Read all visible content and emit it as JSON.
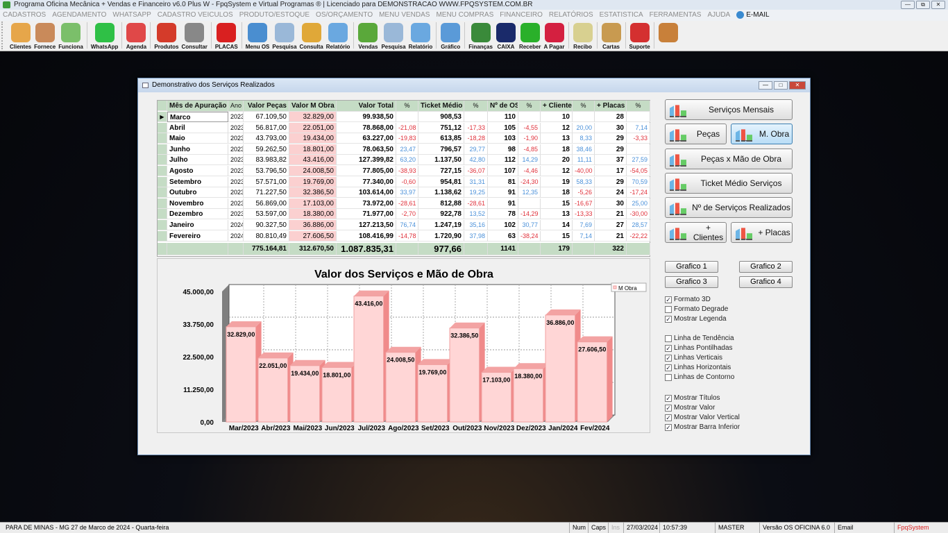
{
  "app": {
    "title": "Programa Oficina Mecânica + Vendas e Financeiro v6.0 Plus W - FpqSystem e Virtual Programas ® | Licenciado para  DEMONSTRACAO WWW.FPQSYSTEM.COM.BR"
  },
  "menu": [
    "CADASTROS",
    "AGENDAMENTO",
    "WHATSAPP",
    "CADASTRO VEICULOS",
    "PRODUTO/ESTOQUE",
    "OS/ORÇAMENTO",
    "MENU VENDAS",
    "MENU COMPRAS",
    "FINANCEIRO",
    "RELATÓRIOS",
    "ESTATISTICA",
    "FERRAMENTAS",
    "AJUDA"
  ],
  "menu_email": "E-MAIL",
  "toolbar": [
    {
      "label": "Clientes",
      "color": "#e6a64a"
    },
    {
      "label": "Fornece",
      "color": "#c98a5a"
    },
    {
      "label": "Funciona",
      "color": "#7bbf6a"
    },
    "|",
    {
      "label": "WhatsApp",
      "color": "#2fc046"
    },
    "|",
    {
      "label": "Agenda",
      "color": "#e04848"
    },
    "|",
    {
      "label": "Produtos",
      "color": "#d43b2a"
    },
    {
      "label": "Consultar",
      "color": "#888888"
    },
    "|",
    {
      "label": "PLACAS",
      "color": "#d92020"
    },
    "|",
    {
      "label": "Menu OS",
      "color": "#4a8ed0"
    },
    {
      "label": "Pesquisa",
      "color": "#9ab8d8"
    },
    {
      "label": "Consulta",
      "color": "#e0a838"
    },
    {
      "label": "Relatório",
      "color": "#6aa8e0"
    },
    "|",
    {
      "label": "Vendas",
      "color": "#5aa83a"
    },
    {
      "label": "Pesquisa",
      "color": "#9ab8d8"
    },
    {
      "label": "Relatório",
      "color": "#6aa8e0"
    },
    "|",
    {
      "label": "Gráfico",
      "color": "#5a9ad8"
    },
    "|",
    {
      "label": "Finanças",
      "color": "#3a8a3a"
    },
    {
      "label": "CAIXA",
      "color": "#1a2a6a"
    },
    {
      "label": "Receber",
      "color": "#2ab02a"
    },
    {
      "label": "A Pagar",
      "color": "#d42040"
    },
    "|",
    {
      "label": "Recibo",
      "color": "#d8d090"
    },
    "|",
    {
      "label": "Cartas",
      "color": "#c89a50"
    },
    "|",
    {
      "label": "Suporte",
      "color": "#d43030"
    },
    "|",
    {
      "label": "",
      "color": "#c8803a"
    }
  ],
  "window": {
    "title": "Demonstrativo dos Serviços Realizados"
  },
  "table": {
    "headers": [
      "Mês de Apuração",
      "Ano",
      "Valor Peças",
      "Valor M Obra",
      "Valor Total",
      "%",
      "Ticket Médio",
      "%",
      "Nº de OS",
      "%",
      "+ Clientes",
      "%",
      "+ Placas",
      "%"
    ],
    "rows": [
      [
        "Marco",
        "2023",
        "67.109,50",
        "32.829,00",
        "99.938,50",
        "",
        "908,53",
        "",
        "110",
        "",
        "10",
        "",
        "28",
        ""
      ],
      [
        "Abril",
        "2023",
        "56.817,00",
        "22.051,00",
        "78.868,00",
        "-21,08",
        "751,12",
        "-17,33",
        "105",
        "-4,55",
        "12",
        "20,00",
        "30",
        "7,14"
      ],
      [
        "Maio",
        "2023",
        "43.793,00",
        "19.434,00",
        "63.227,00",
        "-19,83",
        "613,85",
        "-18,28",
        "103",
        "-1,90",
        "13",
        "8,33",
        "29",
        "-3,33"
      ],
      [
        "Junho",
        "2023",
        "59.262,50",
        "18.801,00",
        "78.063,50",
        "23,47",
        "796,57",
        "29,77",
        "98",
        "-4,85",
        "18",
        "38,46",
        "29",
        ""
      ],
      [
        "Julho",
        "2023",
        "83.983,82",
        "43.416,00",
        "127.399,82",
        "63,20",
        "1.137,50",
        "42,80",
        "112",
        "14,29",
        "20",
        "11,11",
        "37",
        "27,59"
      ],
      [
        "Agosto",
        "2023",
        "53.796,50",
        "24.008,50",
        "77.805,00",
        "-38,93",
        "727,15",
        "-36,07",
        "107",
        "-4,46",
        "12",
        "-40,00",
        "17",
        "-54,05"
      ],
      [
        "Setembro",
        "2023",
        "57.571,00",
        "19.769,00",
        "77.340,00",
        "-0,60",
        "954,81",
        "31,31",
        "81",
        "-24,30",
        "19",
        "58,33",
        "29",
        "70,59"
      ],
      [
        "Outubro",
        "2023",
        "71.227,50",
        "32.386,50",
        "103.614,00",
        "33,97",
        "1.138,62",
        "19,25",
        "91",
        "12,35",
        "18",
        "-5,26",
        "24",
        "-17,24"
      ],
      [
        "Novembro",
        "2023",
        "56.869,00",
        "17.103,00",
        "73.972,00",
        "-28,61",
        "812,88",
        "-28,61",
        "91",
        "",
        "15",
        "-16,67",
        "30",
        "25,00"
      ],
      [
        "Dezembro",
        "2023",
        "53.597,00",
        "18.380,00",
        "71.977,00",
        "-2,70",
        "922,78",
        "13,52",
        "78",
        "-14,29",
        "13",
        "-13,33",
        "21",
        "-30,00"
      ],
      [
        "Janeiro",
        "2024",
        "90.327,50",
        "36.886,00",
        "127.213,50",
        "76,74",
        "1.247,19",
        "35,16",
        "102",
        "30,77",
        "14",
        "7,69",
        "27",
        "28,57"
      ],
      [
        "Fevereiro",
        "2024",
        "80.810,49",
        "27.606,50",
        "108.416,99",
        "-14,78",
        "1.720,90",
        "37,98",
        "63",
        "-38,24",
        "15",
        "7,14",
        "21",
        "-22,22"
      ]
    ],
    "totals": [
      "",
      "",
      "775.164,81",
      "312.670,50",
      "1.087.835,31",
      "",
      "977,66",
      "",
      "1141",
      "",
      "179",
      "",
      "322",
      ""
    ]
  },
  "chart_data": {
    "type": "bar",
    "title": "Valor dos Serviços e Mão de Obra",
    "categories": [
      "Mar/2023",
      "Abr/2023",
      "Mai/2023",
      "Jun/2023",
      "Jul/2023",
      "Ago/2023",
      "Set/2023",
      "Out/2023",
      "Nov/2023",
      "Dez/2023",
      "Jan/2024",
      "Fev/2024"
    ],
    "series": [
      {
        "name": "M Obra",
        "values": [
          32829,
          22051,
          19434,
          18801,
          43416,
          24008.5,
          19769,
          32386.5,
          17103,
          18380,
          36886,
          27606.5
        ]
      }
    ],
    "value_labels": [
      "32.829,00",
      "22.051,00",
      "19.434,00",
      "18.801,00",
      "43.416,00",
      "24.008,50",
      "19.769,00",
      "32.386,50",
      "17.103,00",
      "18.380,00",
      "36.886,00",
      "27.606,50"
    ],
    "yticks": [
      "0,00",
      "11.250,00",
      "22.500,00",
      "33.750,00",
      "45.000,00"
    ],
    "ylim": [
      0,
      45000
    ],
    "legend": "top-right",
    "bar_color": "#ffd6d6",
    "grid": true
  },
  "side": {
    "buttons": [
      "Serviços Mensais",
      "Peças",
      "M. Obra",
      "Peças x Mão de Obra",
      "Ticket Médio Serviços",
      "Nº de Serviços Realizados",
      "+ Clientes",
      "+ Placas"
    ],
    "graficos": [
      "Grafico 1",
      "Grafico 2",
      "Grafico 3",
      "Grafico 4"
    ],
    "options": [
      {
        "label": "Formato 3D",
        "checked": true
      },
      {
        "label": "Formato Degrade",
        "checked": false
      },
      {
        "label": "Mostrar Legenda",
        "checked": true
      },
      {
        "label": "Linha de Tendência",
        "checked": false
      },
      {
        "label": "Linhas Pontilhadas",
        "checked": true
      },
      {
        "label": "Linhas Verticais",
        "checked": true
      },
      {
        "label": "Linhas Horizontais",
        "checked": true
      },
      {
        "label": "Linhas de Contorno",
        "checked": false
      },
      {
        "label": "Mostrar Títulos",
        "checked": true
      },
      {
        "label": "Mostrar Valor",
        "checked": true
      },
      {
        "label": "Mostrar Valor Vertical",
        "checked": true
      },
      {
        "label": "Mostrar Barra Inferior",
        "checked": true
      }
    ]
  },
  "status": {
    "location": "PARA DE MINAS - MG 27 de Marco de 2024 - Quarta-feira",
    "num": "Num",
    "caps": "Caps",
    "ins": "Ins",
    "date": "27/03/2024",
    "time": "10:57:39",
    "user": "MASTER",
    "version": "Versão OS OFICINA 6.0",
    "email": "Email",
    "brand": "FpqSystem"
  }
}
